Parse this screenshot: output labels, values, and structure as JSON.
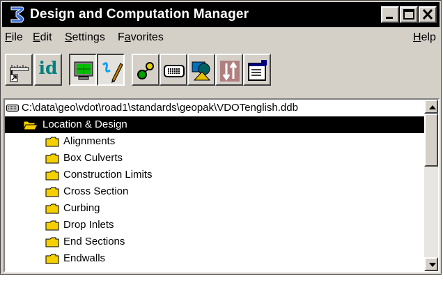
{
  "window": {
    "title": "Design and Computation Manager",
    "app_icon": "geopak-logo-icon",
    "controls": {
      "minimize": "minimize-icon",
      "maximize": "maximize-icon",
      "close": "close-icon"
    }
  },
  "menu": {
    "file": {
      "underline": "F",
      "rest": "ile"
    },
    "edit": {
      "underline": "E",
      "rest": "dit"
    },
    "settings": {
      "underline": "S",
      "rest": "ettings"
    },
    "favorites": {
      "before": "F",
      "underline": "a",
      "rest": "vorites"
    },
    "help": {
      "underline": "H",
      "rest": "elp"
    }
  },
  "toolbar": {
    "buttons": [
      {
        "icon": "ruler-icon"
      },
      {
        "text": "id",
        "icon": "identify-icon"
      },
      {
        "icon": "monitor-icon",
        "pressed": true
      },
      {
        "icon": "draw-pencil-icon",
        "pressed": true
      },
      {
        "icon": "palette-icon"
      },
      {
        "icon": "keyboard-icon"
      },
      {
        "icon": "shapes-icon"
      },
      {
        "icon": "sort-arrows-icon"
      },
      {
        "icon": "properties-dialog-icon"
      }
    ]
  },
  "tree": {
    "database_path": "C:\\data\\geo\\vdot\\road1\\standards\\geopak\\VDOTenglish.ddb",
    "root": "Location & Design",
    "children": [
      "Alignments",
      "Box Culverts",
      "Construction Limits",
      "Cross Section",
      "Curbing",
      "Drop Inlets",
      "End Sections",
      "Endwalls"
    ]
  },
  "colors": {
    "window_bg": "#d4d0c8",
    "titlebar_bg": "#000000",
    "selection_bg": "#000000",
    "folder": "#f5d000",
    "id_text": "#008080"
  }
}
